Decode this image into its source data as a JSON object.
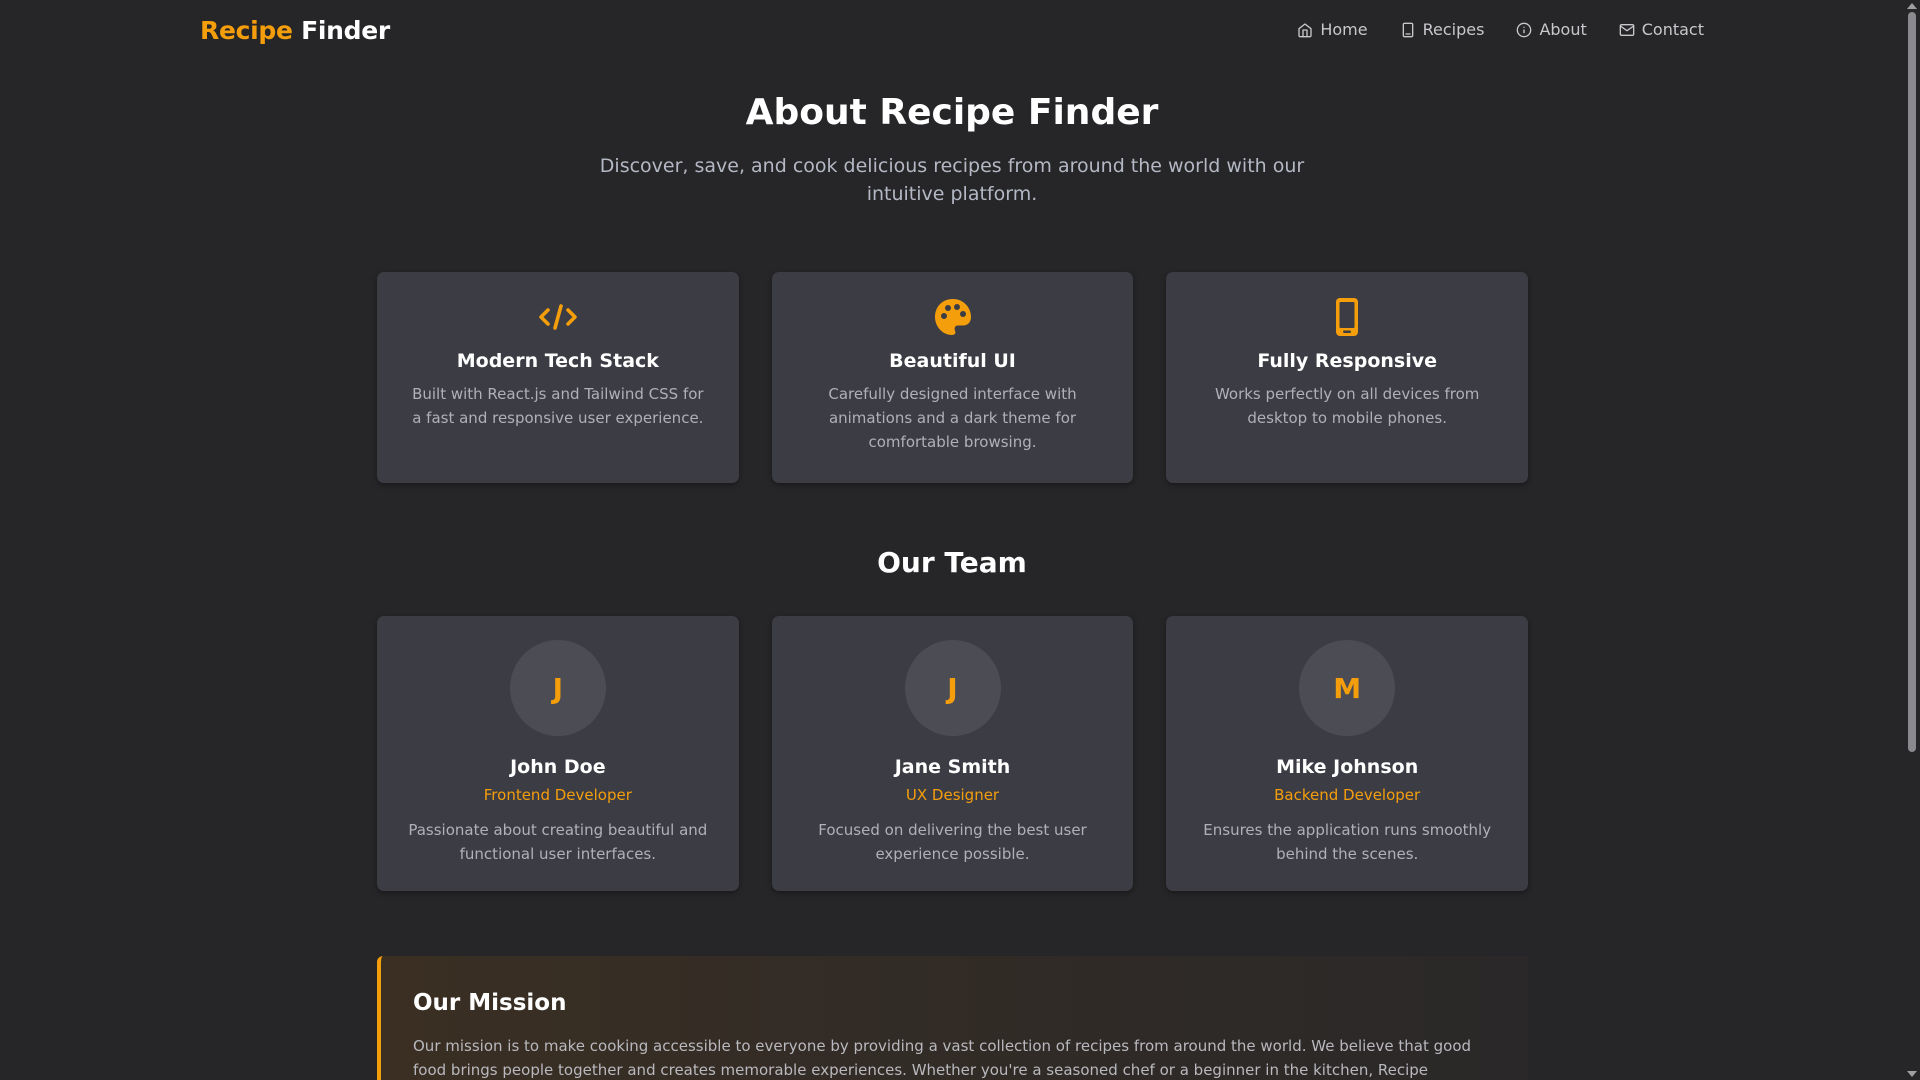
{
  "header": {
    "logo_accent": "Recipe",
    "logo_rest": "Finder",
    "nav": [
      {
        "label": "Home",
        "icon": "home-icon"
      },
      {
        "label": "Recipes",
        "icon": "book-icon"
      },
      {
        "label": "About",
        "icon": "info-icon"
      },
      {
        "label": "Contact",
        "icon": "mail-icon"
      }
    ]
  },
  "hero": {
    "title": "About Recipe Finder",
    "subtitle": "Discover, save, and cook delicious recipes from around the world with our intuitive platform."
  },
  "features": [
    {
      "icon": "code-icon",
      "title": "Modern Tech Stack",
      "text": "Built with React.js and Tailwind CSS for a fast and responsive user experience."
    },
    {
      "icon": "palette-icon",
      "title": "Beautiful UI",
      "text": "Carefully designed interface with animations and a dark theme for comfortable browsing."
    },
    {
      "icon": "mobile-icon",
      "title": "Fully Responsive",
      "text": "Works perfectly on all devices from desktop to mobile phones."
    }
  ],
  "team": {
    "title": "Our Team",
    "members": [
      {
        "initial": "J",
        "name": "John Doe",
        "role": "Frontend Developer",
        "bio": "Passionate about creating beautiful and functional user interfaces."
      },
      {
        "initial": "J",
        "name": "Jane Smith",
        "role": "UX Designer",
        "bio": "Focused on delivering the best user experience possible."
      },
      {
        "initial": "M",
        "name": "Mike Johnson",
        "role": "Backend Developer",
        "bio": "Ensures the application runs smoothly behind the scenes."
      }
    ]
  },
  "mission": {
    "title": "Our Mission",
    "text": "Our mission is to make cooking accessible to everyone by providing a vast collection of recipes from around the world. We believe that good food brings people together and creates memorable experiences. Whether you're a seasoned chef or a beginner in the kitchen, Recipe Finder has"
  },
  "colors": {
    "accent": "#f59e0b",
    "background": "#262628",
    "card": "#3c3c44"
  }
}
